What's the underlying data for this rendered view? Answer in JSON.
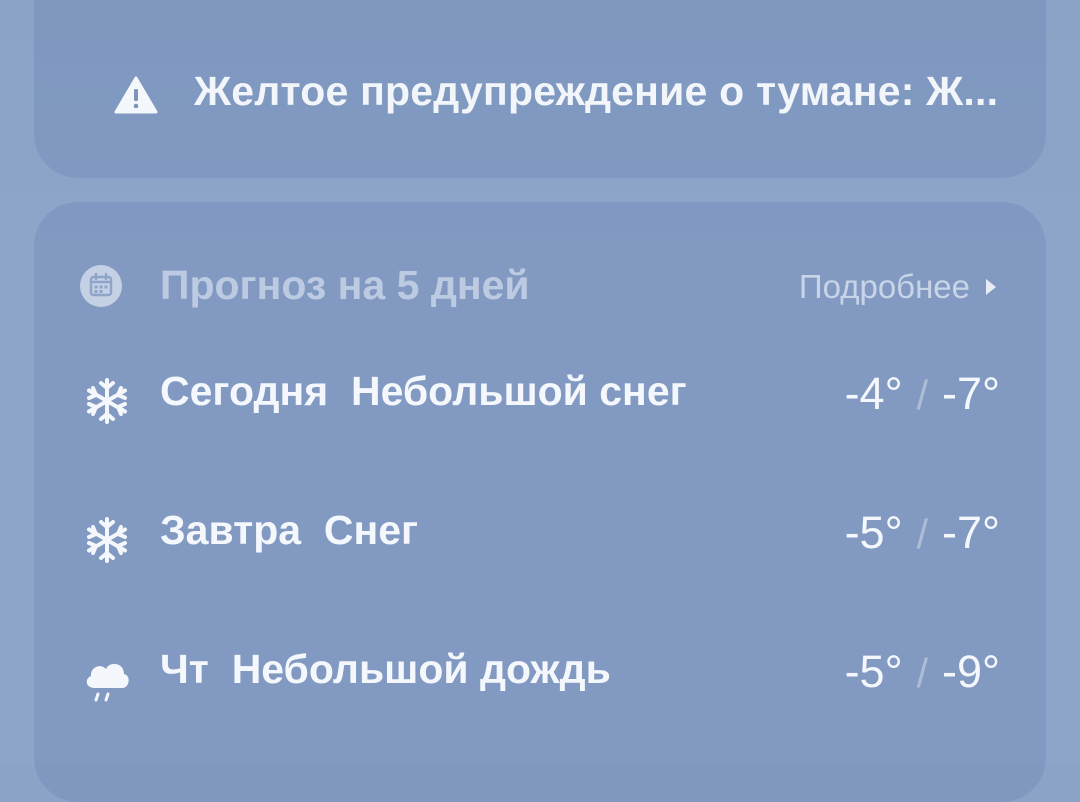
{
  "alert": {
    "icon": "warning-icon",
    "text": "Желтое предупреждение о тумане: Ж..."
  },
  "forecast": {
    "icon": "calendar-icon",
    "title": "Прогноз на 5 дней",
    "more_label": "Подробнее",
    "separator": "/",
    "days": [
      {
        "day": "Сегодня",
        "condition": "Небольшой снег",
        "icon": "snowflake-icon",
        "high": "-4°",
        "low": "-7°"
      },
      {
        "day": "Завтра",
        "condition": "Снег",
        "icon": "snowflake-icon",
        "high": "-5°",
        "low": "-7°"
      },
      {
        "day": "Чт",
        "condition": "Небольшой дождь",
        "icon": "rain-cloud-icon",
        "high": "-5°",
        "low": "-9°"
      }
    ]
  }
}
